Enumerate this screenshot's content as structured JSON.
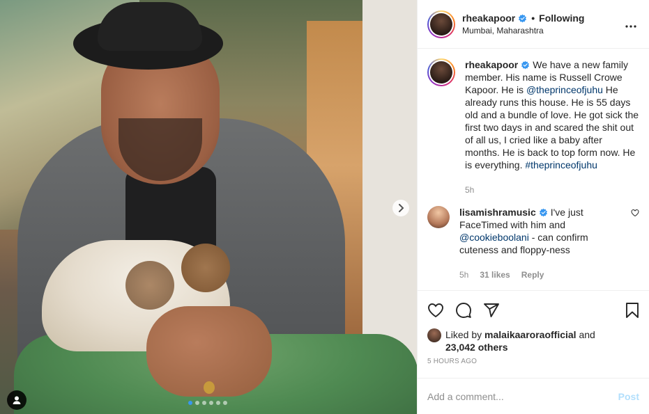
{
  "post": {
    "username": "rheakapoor",
    "separator": "•",
    "follow_state": "Following",
    "location": "Mumbai, Maharashtra"
  },
  "caption": {
    "username": "rheakapoor",
    "text_1": "We have a new family member. His name is Russell Crowe Kapoor. He is ",
    "mention": "@theprinceofjuhu",
    "text_2": " He already runs this house. He is 55 days old and a bundle of love. He got sick the first two days in and scared the shit out of all us, I cried like a baby after months. He is back to top form now. He is everything. ",
    "hashtag": "#theprinceofjuhu",
    "time": "5h"
  },
  "comment": {
    "username": "lisamishramusic",
    "text_1": "I've just FaceTimed with him and ",
    "mention": "@cookieboolani",
    "text_2": " - can confirm cuteness and floppy-ness",
    "time": "5h",
    "likes": "31 likes",
    "reply": "Reply"
  },
  "likes": {
    "prefix": "Liked by ",
    "user": "malaikaaroraofficial",
    "and": " and",
    "others": "23,042 others"
  },
  "timestamp": "5 HOURS AGO",
  "add_comment": {
    "placeholder": "Add a comment...",
    "post_label": "Post"
  },
  "carousel": {
    "total": 6,
    "active": 0
  },
  "colors": {
    "verified": "#3897f0",
    "link": "#00376b",
    "post_disabled": "#b2dffc",
    "muted": "#8e8e8e"
  },
  "icons": [
    "verified-badge-icon",
    "more-options-icon",
    "heart-icon",
    "comment-icon",
    "share-icon",
    "bookmark-icon",
    "chevron-right-icon",
    "user-tag-icon"
  ]
}
